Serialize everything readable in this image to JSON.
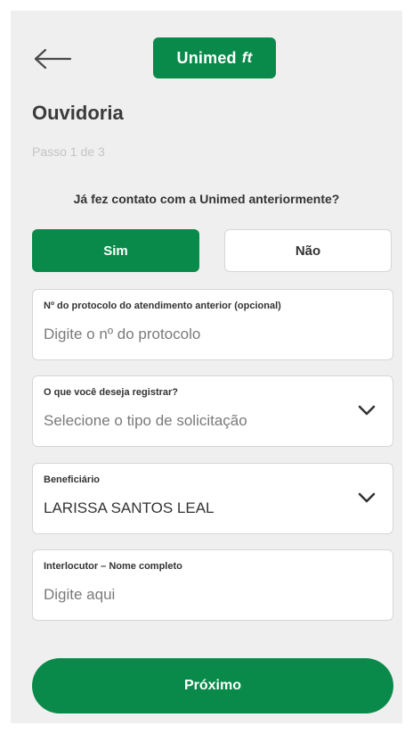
{
  "header": {
    "back_icon": "arrow-left-icon",
    "logo_text": "Unimed",
    "logo_mark": "ft",
    "brand_color": "#0a8a4a"
  },
  "page": {
    "title": "Ouvidoria",
    "step": "Passo 1 de 3"
  },
  "contact": {
    "question": "Já fez contato com a Unimed anteriormente?",
    "yes_label": "Sim",
    "no_label": "Não",
    "selected": "Sim"
  },
  "fields": {
    "protocol": {
      "label": "Nº do protocolo do atendimento anterior (opcional)",
      "placeholder": "Digite o nº do protocolo"
    },
    "request_type": {
      "label": "O que você deseja registrar?",
      "placeholder": "Selecione o tipo de solicitação",
      "icon": "chevron-down-icon"
    },
    "beneficiary": {
      "label": "Beneficiário",
      "value": "LARISSA SANTOS LEAL",
      "icon": "chevron-down-icon"
    },
    "interlocutor": {
      "label": "Interlocutor – Nome completo",
      "placeholder": "Digite aqui"
    }
  },
  "footer": {
    "next_label": "Próximo"
  }
}
